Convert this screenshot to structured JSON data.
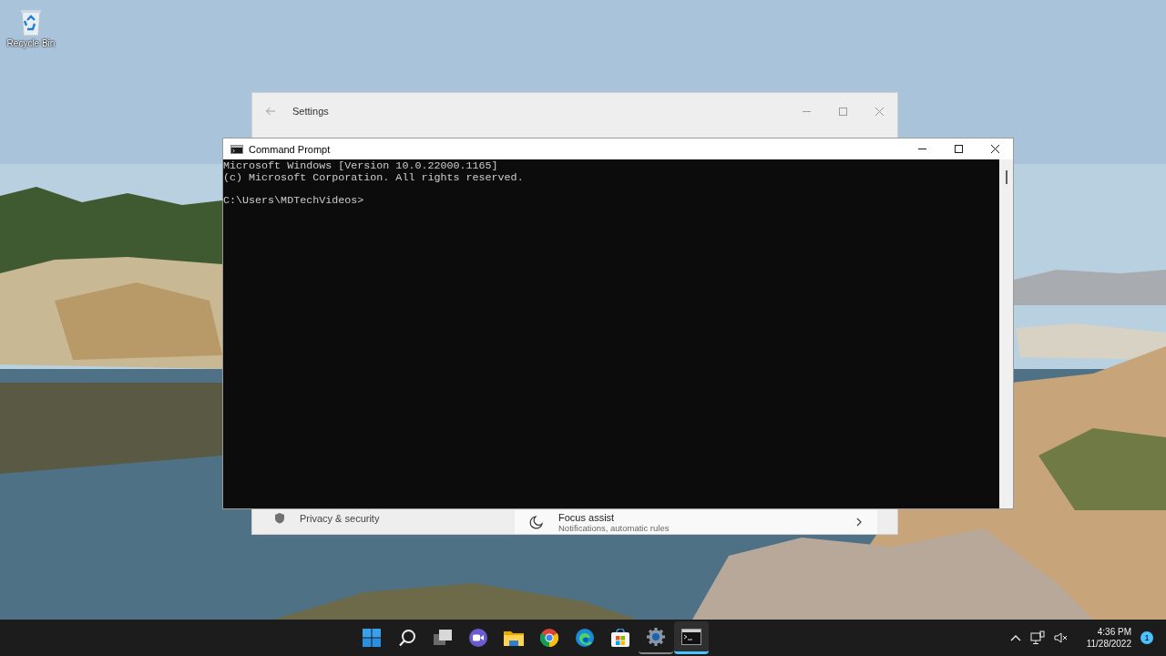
{
  "desktop_icons": [
    {
      "label": "Recycle Bin"
    }
  ],
  "settings_window": {
    "title": "Settings",
    "active": false,
    "nav_items": [
      {
        "label": "Privacy & security"
      }
    ],
    "cards": [
      {
        "title": "Focus assist",
        "subtitle": "Notifications, automatic rules"
      }
    ]
  },
  "cmd_window": {
    "title": "Command Prompt",
    "active": true,
    "lines": [
      "Microsoft Windows [Version 10.0.22000.1165]",
      "(c) Microsoft Corporation. All rights reserved."
    ],
    "prompt": "C:\\Users\\MDTechVideos>"
  },
  "taskbar": {
    "apps": [
      {
        "kind": "start",
        "running": false,
        "active": false
      },
      {
        "kind": "search",
        "running": false,
        "active": false
      },
      {
        "kind": "taskview",
        "running": false,
        "active": false
      },
      {
        "kind": "chat",
        "running": false,
        "active": false
      },
      {
        "kind": "explorer",
        "running": false,
        "active": false
      },
      {
        "kind": "chrome",
        "running": false,
        "active": false
      },
      {
        "kind": "edge",
        "running": false,
        "active": false
      },
      {
        "kind": "store",
        "running": false,
        "active": false
      },
      {
        "kind": "settings",
        "running": true,
        "active": false
      },
      {
        "kind": "terminal",
        "running": true,
        "active": true
      }
    ],
    "time": "4:36 PM",
    "date": "11/28/2022",
    "notification_count": "1"
  }
}
